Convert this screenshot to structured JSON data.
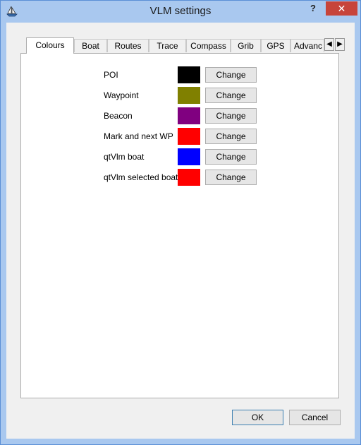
{
  "window": {
    "title": "VLM settings",
    "help_label": "?",
    "close_label": "✕"
  },
  "tabs": [
    "Colours",
    "Boat",
    "Routes",
    "Trace",
    "Compass",
    "Grib",
    "GPS",
    "Advanc"
  ],
  "active_tab": "Colours",
  "tab_scroll": {
    "left": "◀",
    "right": "▶"
  },
  "colours": [
    {
      "label": "POI",
      "color": "#000000",
      "button": "Change"
    },
    {
      "label": "Waypoint",
      "color": "#808000",
      "button": "Change"
    },
    {
      "label": "Beacon",
      "color": "#800080",
      "button": "Change"
    },
    {
      "label": "Mark and next WP",
      "color": "#ff0000",
      "button": "Change"
    },
    {
      "label": "qtVlm boat",
      "color": "#0000ff",
      "button": "Change"
    },
    {
      "label": "qtVlm selected boat.",
      "color": "#ff0000",
      "button": "Change"
    }
  ],
  "footer": {
    "ok_label": "OK",
    "cancel_label": "Cancel"
  }
}
